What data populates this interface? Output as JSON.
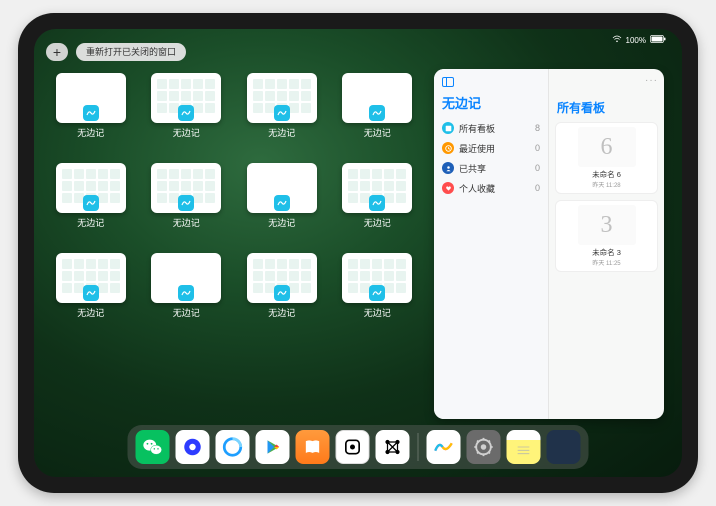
{
  "status": {
    "time": "",
    "battery": "100%"
  },
  "controls": {
    "plus": "+",
    "reopen": "重新打开已关闭的窗口"
  },
  "thumbs": [
    {
      "label": "无边记",
      "blank": true
    },
    {
      "label": "无边记",
      "blank": false
    },
    {
      "label": "无边记",
      "blank": false
    },
    {
      "label": "无边记",
      "blank": true
    },
    {
      "label": "无边记",
      "blank": false
    },
    {
      "label": "无边记",
      "blank": false
    },
    {
      "label": "无边记",
      "blank": true
    },
    {
      "label": "无边记",
      "blank": false
    },
    {
      "label": "无边记",
      "blank": false
    },
    {
      "label": "无边记",
      "blank": true
    },
    {
      "label": "无边记",
      "blank": false
    },
    {
      "label": "无边记",
      "blank": false
    }
  ],
  "panel": {
    "title": "无边记",
    "items": [
      {
        "icon": "all",
        "label": "所有看板",
        "count": "8"
      },
      {
        "icon": "recent",
        "label": "最近使用",
        "count": "0"
      },
      {
        "icon": "shared",
        "label": "已共享",
        "count": "0"
      },
      {
        "icon": "fav",
        "label": "个人收藏",
        "count": "0"
      }
    ],
    "rightTitle": "所有看板",
    "boards": [
      {
        "glyph": "6",
        "name": "未命名 6",
        "sub": "昨天 11:28"
      },
      {
        "glyph": "3",
        "name": "未命名 3",
        "sub": "昨天 11:25"
      }
    ]
  },
  "dock": {
    "icons": [
      {
        "name": "wechat-icon",
        "cls": "di-wechat"
      },
      {
        "name": "quark-icon",
        "cls": "di-quark"
      },
      {
        "name": "qq-browser-icon",
        "cls": "di-qq"
      },
      {
        "name": "play-icon",
        "cls": "di-play"
      },
      {
        "name": "books-icon",
        "cls": "di-books"
      },
      {
        "name": "dice-icon",
        "cls": "di-dice"
      },
      {
        "name": "graph-icon",
        "cls": "di-node"
      }
    ],
    "recent": [
      {
        "name": "freeform-icon",
        "cls": "di-freeform"
      },
      {
        "name": "settings-icon",
        "cls": "di-settings"
      },
      {
        "name": "notes-icon",
        "cls": "di-notes"
      },
      {
        "name": "app-library-icon",
        "cls": "di-folder"
      }
    ]
  }
}
